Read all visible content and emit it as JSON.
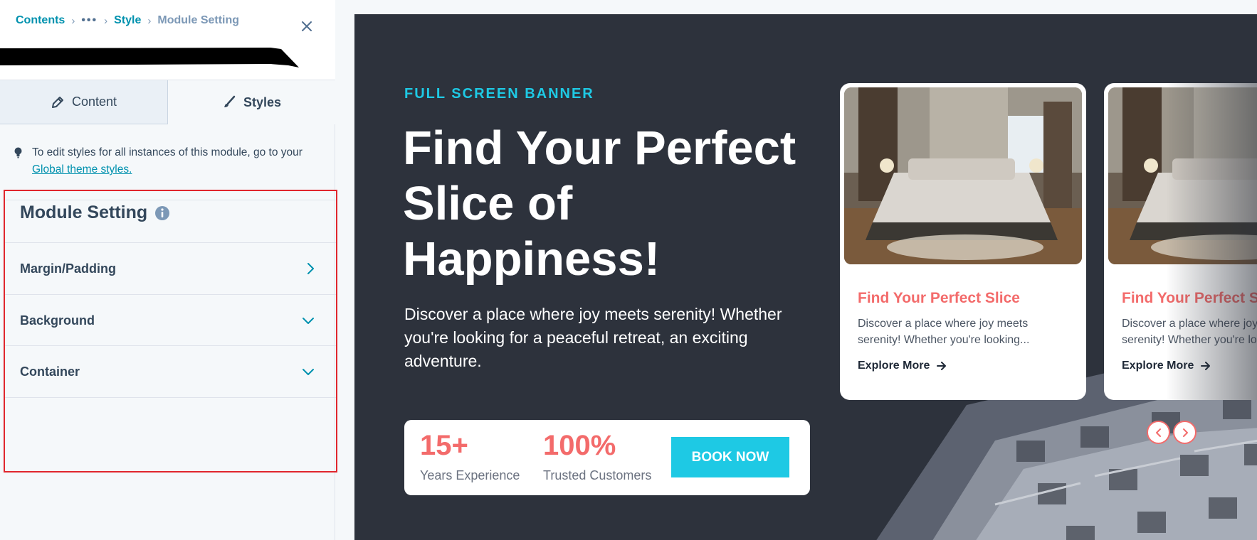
{
  "breadcrumb": {
    "contents": "Contents",
    "ellipsis": "•••",
    "style": "Style",
    "current": "Module Setting"
  },
  "tabs": [
    {
      "label": "Content",
      "icon": "pencil-icon"
    },
    {
      "label": "Styles",
      "icon": "brush-icon",
      "active": true
    }
  ],
  "hint": {
    "text": "To edit styles for all instances of this module, go to your ",
    "link": "Global theme styles."
  },
  "settings": {
    "title": "Module Setting",
    "rows": [
      {
        "label": "Margin/Padding",
        "icon": "chevron-right-icon"
      },
      {
        "label": "Background",
        "icon": "chevron-down-icon"
      },
      {
        "label": "Container",
        "icon": "chevron-down-icon"
      }
    ]
  },
  "hero": {
    "eyebrow": "FULL SCREEN BANNER",
    "title": "Find Your Perfect Slice of Happiness!",
    "description": "Discover a place where joy meets serenity! Whether you're looking for a peaceful retreat, an exciting adventure."
  },
  "stats": [
    {
      "number": "15+",
      "label": "Years Experience"
    },
    {
      "number": "100%",
      "label": "Trusted Customers"
    }
  ],
  "cta": {
    "label": "BOOK NOW"
  },
  "cards": [
    {
      "title": "Find Your Perfect Slice",
      "text": "Discover a place where joy meets serenity! Whether you're looking...",
      "link": "Explore More"
    },
    {
      "title": "Find Your Perfect Slice",
      "text": "Discover a place where joy meets serenity! Whether you're looking...",
      "link": "Explore More"
    }
  ],
  "colors": {
    "accent_cyan": "#1ec9e4",
    "accent_coral": "#f36b6b",
    "banner_bg": "#2d323c",
    "link_teal": "#0091ae",
    "highlight_red": "#e0262d"
  }
}
